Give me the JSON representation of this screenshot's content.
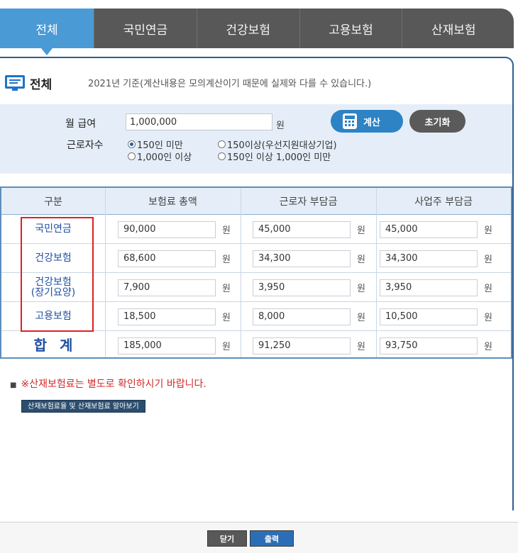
{
  "tabs": [
    {
      "label": "전체",
      "active": true
    },
    {
      "label": "국민연금"
    },
    {
      "label": "건강보험"
    },
    {
      "label": "고용보험"
    },
    {
      "label": "산재보험"
    }
  ],
  "section": {
    "title": "전체",
    "note": "2021년 기준(계산내용은 모의계산이기 때문에 실제와 다를 수 있습니다.)"
  },
  "form": {
    "salary_label": "월 급여",
    "salary_value": "1,000,000",
    "unit": "원",
    "workers_label": "근로자수",
    "options": [
      "150인 미만",
      "150이상(우선지원대상기업)",
      "1,000인 이상",
      "150인 이상 1,000인 미만"
    ],
    "calc_button": "계산",
    "reset_button": "초기화"
  },
  "table": {
    "headers": [
      "구분",
      "보험료 총액",
      "근로자 부담금",
      "사업주 부담금"
    ],
    "rows": [
      {
        "label": "국민연금",
        "total": "90,000",
        "worker": "45,000",
        "employer": "45,000"
      },
      {
        "label": "건강보험",
        "total": "68,600",
        "worker": "34,300",
        "employer": "34,300"
      },
      {
        "label": "건강보험\n(장기요양)",
        "total": "7,900",
        "worker": "3,950",
        "employer": "3,950"
      },
      {
        "label": "고용보험",
        "total": "18,500",
        "worker": "8,000",
        "employer": "10,500"
      },
      {
        "label": "합계",
        "total": "185,000",
        "worker": "91,250",
        "employer": "93,750"
      }
    ],
    "unit": "원"
  },
  "notice": {
    "bullet": "■",
    "text": "※산재보험료는 별도로 확인하시기 바랍니다.",
    "link": "산재보험료율 및 산재보험료 알아보기"
  },
  "footer": {
    "close": "닫기",
    "print": "출력"
  },
  "colors": {
    "accent": "#4a9ad6",
    "tab_bg": "#585858",
    "frame": "#2c5f8f",
    "panel_bg": "#e5eef8",
    "label_blue": "#1f4f9e",
    "notice_red": "#d22a2a",
    "highlight": "#e02020"
  }
}
